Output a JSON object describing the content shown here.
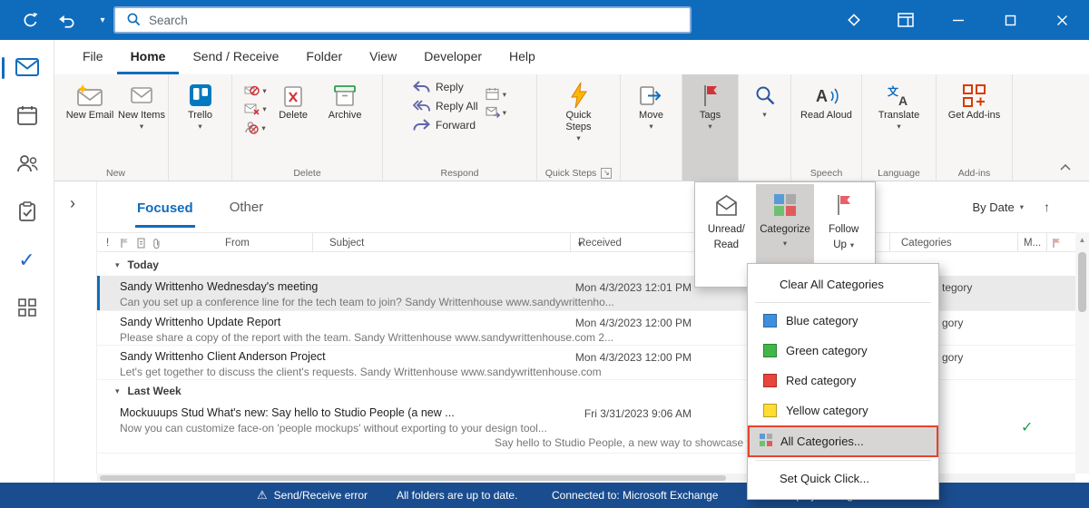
{
  "titlebar": {
    "search_placeholder": "Search"
  },
  "icons": {
    "chevron_down": "▾",
    "sort_down": "▾",
    "up_arrow": "↑",
    "scroll_up": "▲",
    "expand_pane": "›",
    "check": "✓",
    "warning": "⚠",
    "importance": "!",
    "dialog_launcher": "↘",
    "read_aloud_letter": "A",
    "translate_cjk": "文",
    "translate_latin": "A"
  },
  "ribbon": {
    "tabs": [
      "File",
      "Home",
      "Send / Receive",
      "Folder",
      "View",
      "Developer",
      "Help"
    ],
    "active_tab": "Home",
    "buttons": {
      "new_email": "New Email",
      "new_items": "New Items",
      "trello": "Trello",
      "delete": "Delete",
      "archive": "Archive",
      "reply": "Reply",
      "reply_all": "Reply All",
      "forward": "Forward",
      "quick_steps": "Quick Steps",
      "move": "Move",
      "tags": "Tags",
      "read_aloud": "Read Aloud",
      "translate": "Translate",
      "get_addins": "Get Add-ins"
    },
    "groups": {
      "new": "New",
      "delete": "Delete",
      "respond": "Respond",
      "quick_steps": "Quick Steps",
      "speech": "Speech",
      "language": "Language",
      "addins": "Add-ins"
    }
  },
  "tags_popup": {
    "items": [
      {
        "line1": "Unread/",
        "line2": "Read"
      },
      {
        "line1": "Categorize",
        "line2": ""
      },
      {
        "line1": "Follow",
        "line2": "Up"
      }
    ]
  },
  "categorize_menu": {
    "items": [
      {
        "label": "Clear All Categories"
      },
      {
        "label": "Blue category",
        "swatch": "#3f8fde"
      },
      {
        "label": "Green category",
        "swatch": "#42b649"
      },
      {
        "label": "Red category",
        "swatch": "#e8453c"
      },
      {
        "label": "Yellow category",
        "swatch": "#ffdd33"
      },
      {
        "label": "All Categories..."
      },
      {
        "label": "Set Quick Click..."
      }
    ]
  },
  "message_list": {
    "view_tabs": [
      "Focused",
      "Other"
    ],
    "active_view_tab": "Focused",
    "sort_label": "By Date",
    "columns": {
      "from": "From",
      "subject": "Subject",
      "received": "Received",
      "categories": "Categories",
      "mentions": "M..."
    },
    "groups": [
      {
        "label": "Today",
        "emails": [
          {
            "from": "Sandy Writtenho...",
            "subject": "Wednesday's meeting",
            "received": "Mon 4/3/2023 12:01 PM",
            "preview": "Can you set up a conference line for the tech team to join?  Sandy Writtenhouse  www.sandywrittenho...",
            "category_fragment": "tegory"
          },
          {
            "from": "Sandy Writtenho...",
            "subject": "Update Report",
            "received": "Mon 4/3/2023 12:00 PM",
            "preview": "Please share a copy of the report with the team.  Sandy Writtenhouse  www.sandywrittenhouse.com 2...",
            "category_fragment": "gory"
          },
          {
            "from": "Sandy Writtenho...",
            "subject": "Client Anderson Project",
            "received": "Mon 4/3/2023 12:00 PM",
            "preview": "Let's get together to discuss the client's requests.  Sandy Writtenhouse  www.sandywrittenhouse.com",
            "category_fragment": "gory"
          }
        ]
      },
      {
        "label": "Last Week",
        "emails": [
          {
            "from": "Mockuuups Stud...",
            "subject": "What's new: Say hello to Studio People (a new ...",
            "received": "Fri 3/31/2023 9:06 AM",
            "preview": "Now you can customize face-on 'people mockups' without exporting to your design tool...",
            "preview2": "Say hello to Studio People, a new way to showcase your work"
          }
        ]
      }
    ]
  },
  "statusbar": {
    "items": [
      "Send/Receive error",
      "All folders are up to date.",
      "Connected to: Microsoft Exchange",
      "Display Settings"
    ]
  },
  "colors": {
    "titlebar": "#0f6cbd",
    "statusbar": "#1a4d8f",
    "accent": "#0f6cbd",
    "pressed_gray": "#d2d0ce",
    "annotation_red": "#e8432d"
  }
}
